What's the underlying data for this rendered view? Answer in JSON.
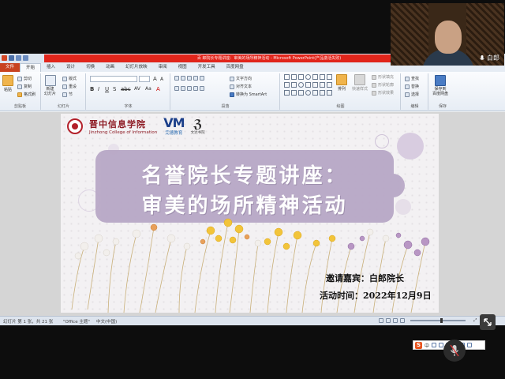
{
  "window": {
    "title": "百 郎院长专题讲座：审美的场所精神活动 - Microsoft PowerPoint(产品激活失败)"
  },
  "ribbon": {
    "tabs": [
      "文件",
      "开始",
      "插入",
      "设计",
      "切换",
      "动画",
      "幻灯片放映",
      "审阅",
      "视图",
      "开发工具",
      "百度网盘"
    ],
    "active_tab": "开始",
    "clipboard": {
      "paste": "粘贴",
      "cut": "剪切",
      "copy": "复制",
      "format_painter": "格式刷",
      "group": "剪贴板"
    },
    "slides": {
      "new_slide": "新建\n幻灯片",
      "layout": "版式",
      "reset": "重设",
      "section": "节",
      "group": "幻灯片"
    },
    "font_group": "字体",
    "paragraph": {
      "text_direction": "文字方向",
      "align_text": "对齐文本",
      "smartart": "转换为 SmartArt",
      "group": "段落"
    },
    "drawing": {
      "arrange": "排列",
      "quick_styles": "快速样式",
      "fill": "形状填充",
      "outline": "形状轮廓",
      "effects": "形状效果",
      "group": "绘图"
    },
    "editing": {
      "find": "查找",
      "replace": "替换",
      "select": "选择",
      "group": "编辑"
    },
    "baidu": {
      "save": "保存到\n百度网盘",
      "group": "保存"
    }
  },
  "slide": {
    "school_name": "晋中信息学院",
    "school_en": "Jinzhong College of Information",
    "partner_mark": "VM",
    "partner_name": "完德教育",
    "partner2_sub": "文达书院",
    "title_line1": "名誉院长专题讲座：",
    "title_line2": "审美的场所精神活动",
    "guest": "邀请嘉宾：白郎院长",
    "date": "活动时间：2022年12月9日"
  },
  "ime": {
    "logo": "S",
    "mode": "中"
  },
  "status": {
    "slide_count": "幻灯片 第 1 张，共 21 张",
    "theme": "\"Office 主题\"",
    "language": "中文(中国)"
  },
  "video": {
    "participant_name": "白郎"
  },
  "colors": {
    "accent_red": "#e1251b",
    "title_card": "#b8a8c6",
    "file_tab": "#c8421f"
  }
}
